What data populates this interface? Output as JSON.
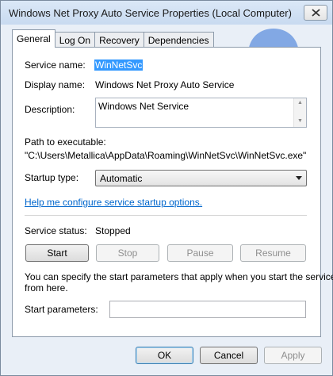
{
  "window": {
    "title": "Windows Net Proxy Auto Service Properties (Local Computer)"
  },
  "tabs": [
    {
      "label": "General",
      "active": true
    },
    {
      "label": "Log On",
      "active": false
    },
    {
      "label": "Recovery",
      "active": false
    },
    {
      "label": "Dependencies",
      "active": false
    }
  ],
  "general": {
    "service_name_label": "Service name:",
    "service_name_value": "WinNetSvc",
    "display_name_label": "Display name:",
    "display_name_value": "Windows Net Proxy Auto Service",
    "description_label": "Description:",
    "description_value": "Windows Net Service",
    "path_label": "Path to executable:",
    "path_value": "\"C:\\Users\\Metallica\\AppData\\Roaming\\WinNetSvc\\WinNetSvc.exe\"",
    "startup_type_label": "Startup type:",
    "startup_type_value": "Automatic",
    "help_link": "Help me configure service startup options.",
    "status_label": "Service status:",
    "status_value": "Stopped",
    "buttons": {
      "start": "Start",
      "stop": "Stop",
      "pause": "Pause",
      "resume": "Resume"
    },
    "info_text_line1": "You can specify the start parameters that apply when you start the service",
    "info_text_line2": "from here.",
    "start_params_label": "Start parameters:",
    "start_params_value": ""
  },
  "footer": {
    "ok": "OK",
    "cancel": "Cancel",
    "apply": "Apply"
  },
  "colors": {
    "selection": "#3399ff",
    "link": "#0066cc",
    "watermark": "#2f6fd6"
  },
  "icons": {
    "close": "close-icon",
    "dropdown": "chevron-down-icon",
    "watermark": "malwarebytes-logo"
  }
}
